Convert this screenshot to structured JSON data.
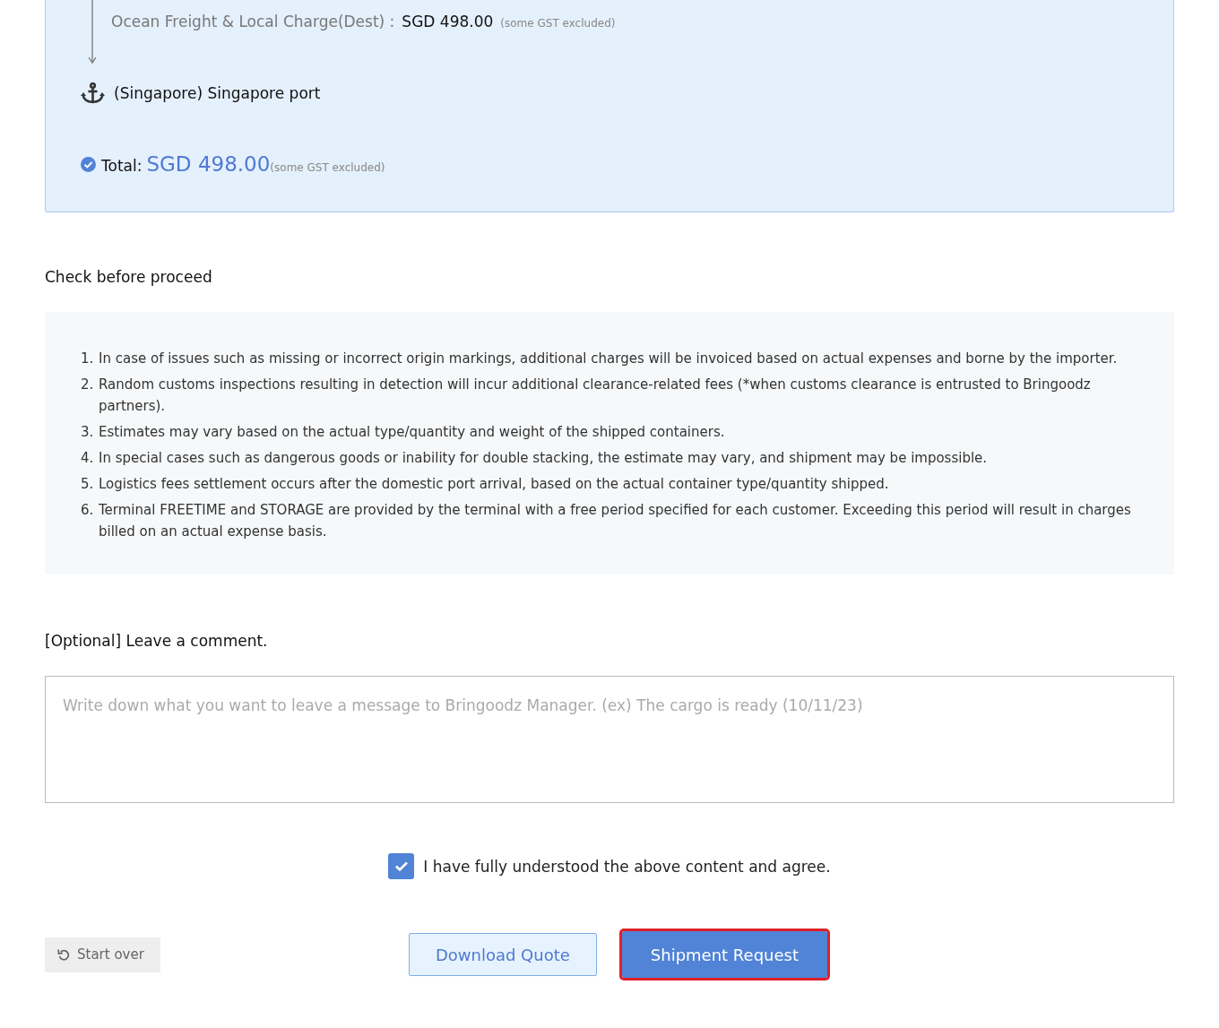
{
  "route": {
    "charge_label": "Ocean Freight & Local Charge(Dest) :",
    "charge_amount": "SGD 498.00",
    "charge_note": "(some GST excluded)",
    "port": "(Singapore) Singapore port",
    "total_label": "Total:",
    "total_amount": "SGD 498.00",
    "total_note": "(some GST excluded)"
  },
  "checklist": {
    "title": "Check before proceed",
    "items": [
      {
        "number": "1.",
        "text": "In case of issues such as missing or incorrect origin markings, additional charges will be invoiced based on actual expenses and borne by the importer."
      },
      {
        "number": "2.",
        "text": "Random customs inspections resulting in detection will incur additional clearance-related fees (*when customs clearance is entrusted to Bringoodz partners)."
      },
      {
        "number": "3.",
        "text": "Estimates may vary based on the actual type/quantity and weight of the shipped containers."
      },
      {
        "number": "4.",
        "text": "In special cases such as dangerous goods or inability for double stacking, the estimate may vary, and shipment may be impossible."
      },
      {
        "number": "5.",
        "text": "Logistics fees settlement occurs after the domestic port arrival, based on the actual container type/quantity shipped."
      },
      {
        "number": "6.",
        "text": "Terminal FREETIME and STORAGE are provided by the terminal with a free period specified for each customer. Exceeding this period will result in charges billed on an actual expense basis."
      }
    ]
  },
  "comment": {
    "title": "[Optional] Leave a comment.",
    "placeholder": "Write down what you want to leave a message to Bringoodz Manager. (ex) The cargo is ready (10/11/23)"
  },
  "agreement": {
    "label": "I have fully understood the above content and agree.",
    "checked": true
  },
  "buttons": [
    {
      "kind": "reset",
      "label": "Start over",
      "highlighted": false
    },
    {
      "kind": "secondary",
      "label": "Download Quote",
      "highlighted": false
    },
    {
      "kind": "primary",
      "label": "Shipment Request",
      "highlighted": true
    }
  ]
}
